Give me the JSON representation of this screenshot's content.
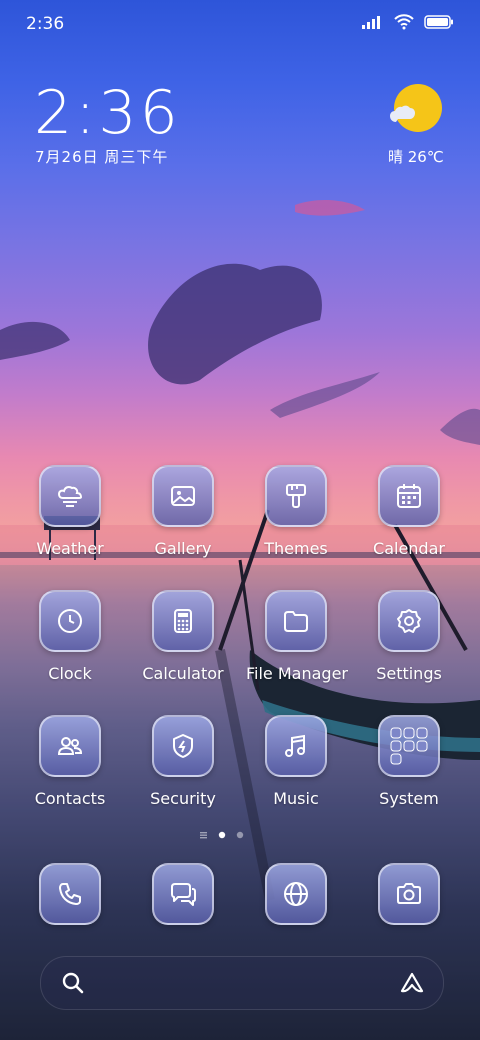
{
  "status_bar": {
    "time": "2:36"
  },
  "clock_widget": {
    "time": "2:36",
    "date": "7月26日 周三下午"
  },
  "weather_widget": {
    "text": "晴 26℃",
    "icon": "sunny-partly-cloudy-icon"
  },
  "apps": [
    {
      "label": "Weather",
      "icon": "weather-cloud-icon"
    },
    {
      "label": "Gallery",
      "icon": "image-icon"
    },
    {
      "label": "Themes",
      "icon": "paintbrush-icon"
    },
    {
      "label": "Calendar",
      "icon": "calendar-icon"
    },
    {
      "label": "Clock",
      "icon": "clock-icon"
    },
    {
      "label": "Calculator",
      "icon": "calculator-icon"
    },
    {
      "label": "File Manager",
      "icon": "folder-icon"
    },
    {
      "label": "Settings",
      "icon": "gear-icon"
    },
    {
      "label": "Contacts",
      "icon": "contacts-icon"
    },
    {
      "label": "Security",
      "icon": "shield-icon"
    },
    {
      "label": "Music",
      "icon": "music-note-icon"
    },
    {
      "label": "System",
      "icon": "folder-grid-icon"
    }
  ],
  "page_indicator": {
    "pages": 2,
    "current": 1
  },
  "dock": [
    {
      "icon": "phone-icon"
    },
    {
      "icon": "messages-icon"
    },
    {
      "icon": "browser-globe-icon"
    },
    {
      "icon": "camera-icon"
    }
  ],
  "search_bar": {
    "left_icon": "search-icon",
    "right_icon": "assistant-icon"
  },
  "colors": {
    "icon_bg_top": "#a0aae6",
    "icon_bg_bottom": "#5a60aa",
    "sun": "#f5c518"
  }
}
